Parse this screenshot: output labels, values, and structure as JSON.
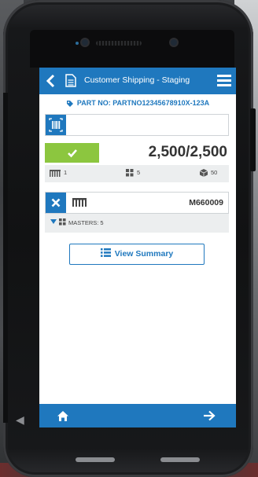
{
  "header": {
    "title": "Customer Shipping - Staging",
    "back_icon": "back-chevron-icon",
    "doc_icon": "document-icon",
    "menu_icon": "hamburger-menu-icon"
  },
  "part": {
    "text": "PART NO: PARTNO12345678910X-123A",
    "icon": "tag-icon"
  },
  "scan": {
    "icon": "barcode-scan-icon",
    "value": ""
  },
  "progress": {
    "quantity": "2,500/2,500",
    "status_icon": "checkmark-icon",
    "stats": [
      {
        "icon": "pallet-icon",
        "value": "1"
      },
      {
        "icon": "grid-icon",
        "value": "5"
      },
      {
        "icon": "box-icon",
        "value": "50"
      }
    ]
  },
  "master": {
    "id": "M660009",
    "remove_icon": "x-icon",
    "type_icon": "pallet-icon",
    "masters_label": "MASTERS: 5"
  },
  "summary_button": {
    "label": "View Summary",
    "icon": "list-icon"
  },
  "footer": {
    "home_icon": "home-icon",
    "next_icon": "arrow-right-icon"
  },
  "colors": {
    "primary": "#1f78be",
    "success": "#8cc63f",
    "panel": "#eceeef",
    "text": "#333333"
  }
}
